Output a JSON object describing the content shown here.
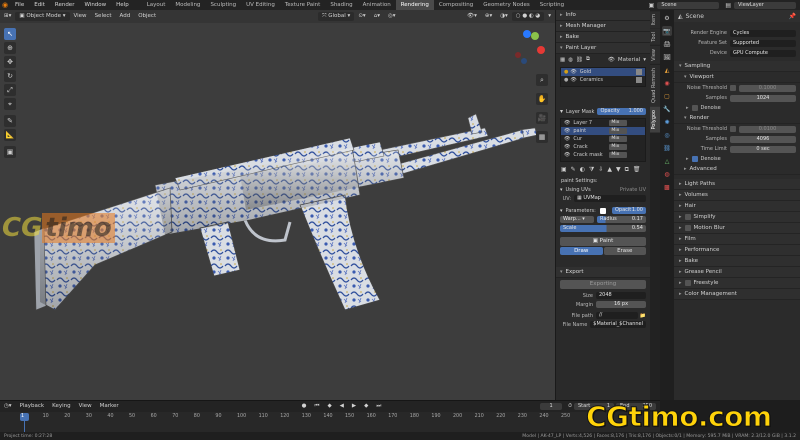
{
  "topbar": {
    "menus": [
      "File",
      "Edit",
      "Render",
      "Window",
      "Help"
    ],
    "workspaces": [
      "Layout",
      "Modeling",
      "Sculpting",
      "UV Editing",
      "Texture Paint",
      "Shading",
      "Animation",
      "Rendering",
      "Compositing",
      "Geometry Nodes",
      "Scripting"
    ],
    "active_workspace": "Rendering",
    "scene": "Scene",
    "view_layer": "ViewLayer"
  },
  "viewport": {
    "mode": "Object Mode",
    "menus": [
      "View",
      "Select",
      "Add",
      "Object"
    ],
    "transform": "Global",
    "colors": {
      "background": "#3d3d3d",
      "accent": "#4772b3"
    }
  },
  "npanel": {
    "sections": {
      "info": "Info",
      "mesh_manager": "Mesh Manager",
      "bake": "Bake",
      "paint_layer": "Paint Layer"
    },
    "material_label": "Material",
    "materials": [
      "Gold",
      "Ceramics"
    ],
    "layer_mask": "Layer Mask",
    "opacity_label": "Opacity",
    "opacity_value": "1.000",
    "layers": [
      {
        "name": "Layer 7",
        "blend": "Mix"
      },
      {
        "name": "paint",
        "blend": "Mix"
      },
      {
        "name": "Cur",
        "blend": "Mix"
      },
      {
        "name": "Crack",
        "blend": "Mix"
      },
      {
        "name": "Crack mask",
        "blend": "Mix"
      }
    ],
    "paint_settings": "paint Settings:",
    "using_uvs": "Using UVs",
    "private_uv": "Private UV",
    "uv_label": "UV:",
    "uv_map": "UVMap",
    "parameters": "Parameters:",
    "opacity_short": "Opacit",
    "opacity_short_value": "1.00",
    "warp": "Warp...",
    "radius_label": "Radius",
    "radius_value": "0.17",
    "scale_label": "Scale",
    "scale_value": "0.54",
    "paint_button": "Paint",
    "draw": "Draw",
    "erase": "Erase",
    "export": "Export",
    "exporting": "Exporting",
    "size_label": "Size",
    "size_value": "2048",
    "margin_label": "Margin",
    "margin_value": "16 px",
    "filepath_label": "File path",
    "filepath_value": "//",
    "filename_label": "File Name",
    "filename_value": "$Material_$Channel"
  },
  "ntabs": [
    "Item",
    "Tool",
    "View",
    "Quad Remesh",
    "Polygoo"
  ],
  "ntab_active": "Polygoo",
  "properties": {
    "scene_name": "Scene",
    "render_engine_label": "Render Engine",
    "render_engine": "Cycles",
    "feature_set_label": "Feature Set",
    "feature_set": "Supported",
    "device_label": "Device",
    "device": "GPU Compute",
    "sampling": "Sampling",
    "viewport": "Viewport",
    "vp_noise_label": "Noise Threshold",
    "vp_noise": "0.1000",
    "vp_samples_label": "Samples",
    "vp_samples": "1024",
    "vp_denoise": "Denoise",
    "render": "Render",
    "r_noise_label": "Noise Threshold",
    "r_noise": "0.0100",
    "r_samples_label": "Samples",
    "r_samples": "4096",
    "time_limit_label": "Time Limit",
    "time_limit": "0 sec",
    "r_denoise": "Denoise",
    "advanced": "Advanced",
    "sections": [
      "Light Paths",
      "Volumes",
      "Hair",
      "Simplify",
      "Motion Blur",
      "Film",
      "Performance",
      "Bake",
      "Grease Pencil",
      "Freestyle",
      "Color Management"
    ]
  },
  "timeline": {
    "menus": [
      "Playback",
      "Keying",
      "View",
      "Marker"
    ],
    "current_frame": "1",
    "start_label": "Start",
    "start": "1",
    "end_label": "End",
    "end": "250",
    "ticks": [
      "1",
      "10",
      "20",
      "30",
      "40",
      "50",
      "60",
      "70",
      "80",
      "90",
      "100",
      "110",
      "120",
      "130",
      "140",
      "150",
      "160",
      "170",
      "180",
      "190",
      "200",
      "210",
      "220",
      "230",
      "240",
      "250"
    ]
  },
  "status": {
    "left": "Project time: 0:27:28",
    "right": "Model | AK-47_LP | Verts:4,526 | Faces:8,176 | Tris:8,176 | Objects:0/1 | Memory: 595.7 MiB | VRAM: 2.3/12.0 GiB | 3.1.2"
  },
  "watermarks": {
    "bottom_right": "CGtimo.com",
    "viewport_left": "CG",
    "viewport_left_box": "timo"
  }
}
